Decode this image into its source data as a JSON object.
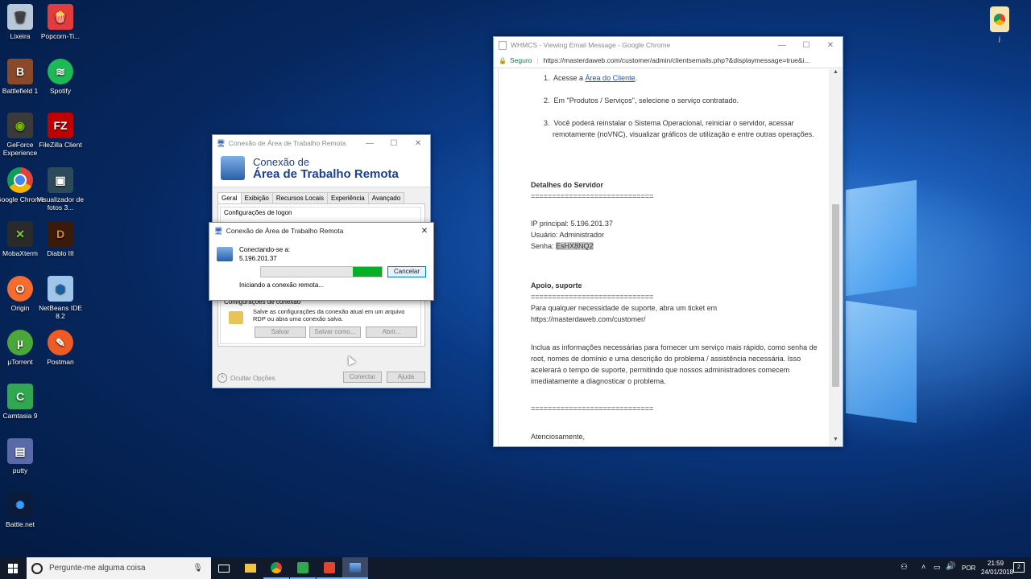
{
  "desktop": {
    "icons": [
      {
        "label": "Lixeira"
      },
      {
        "label": "Popcorn-Ti..."
      },
      {
        "label": "Battlefield 1"
      },
      {
        "label": "Spotify"
      },
      {
        "label": "GeForce Experience"
      },
      {
        "label": "FileZilla Client"
      },
      {
        "label": "Google Chrome"
      },
      {
        "label": "Visualizador de fotos 3..."
      },
      {
        "label": "MobaXterm"
      },
      {
        "label": "Diablo III"
      },
      {
        "label": "Origin"
      },
      {
        "label": "NetBeans IDE 8.2"
      },
      {
        "label": "µTorrent"
      },
      {
        "label": "Postman"
      },
      {
        "label": "Camtasia 9"
      },
      {
        "label": "putty"
      },
      {
        "label": "Battle.net"
      },
      {
        "label": "j"
      }
    ]
  },
  "rdp": {
    "title": "Conexão de Área de Trabalho Remota",
    "banner_line1": "Conexão de",
    "banner_line2": "Área de Trabalho Remota",
    "tabs": [
      "Geral",
      "Exibição",
      "Recursos Locais",
      "Experiência",
      "Avançado"
    ],
    "logon_group": "Configurações de logon",
    "conn_group": "Configurações de conexão",
    "conn_text": "Salve as configurações da conexão atual em um arquivo RDP ou abra uma conexão salva.",
    "save_label": "Salvar",
    "save_as_label": "Salvar como...",
    "open_label": "Abrir...",
    "hide_options": "Ocultar Opções",
    "connect_label": "Conectar",
    "help_label": "Ajuda"
  },
  "connecting": {
    "title": "Conexão de Área de Trabalho Remota",
    "connecting_to": "Conectando-se a:",
    "ip": "5.196.201.37",
    "status": "Iniciando a conexão remota...",
    "cancel_label": "Cancelar"
  },
  "chrome": {
    "title": "WHMCS - Viewing Email Message - Google Chrome",
    "secure_label": "Seguro",
    "url": "https://masterdaweb.com/customer/admin/clientsemails.php?&displaymessage=true&i...",
    "item1_prefix": "Acesse a ",
    "item1_link": "Área do Cliente",
    "item1_suffix": ".",
    "item2": "Em \"Produtos / Serviços\", selecione o serviço contratado.",
    "item3_l1": "Você poderá reinstalar o Sistema Operacional, reiniciar o servidor, acessar",
    "item3_l2": "remotamente (noVNC), visualizar gráficos de utilização e entre outras operações.",
    "details_title": "Detalhes do Servidor",
    "separator": "=============================",
    "ip_line": "IP principal: 5.196.201.37",
    "user_line": "Usuário: Administrador",
    "pass_label": "Senha: ",
    "pass_value": "EsHX8NQ2",
    "support_title": "Apoio, suporte",
    "support_l1": "Para qualquer necessidade de suporte, abra um ticket em",
    "support_l2": "https://masterdaweb.com/customer/",
    "info_l1": "Inclua as informações necessárias para fornecer um serviço mais rápido, como senha de",
    "info_l2": "root, nomes de domínio e uma descrição do problema / assistência necessária. Isso",
    "info_l3": "acelerará o tempo de suporte, permitindo que nossos administradores comecem",
    "info_l4": "imediatamente a diagnosticar o problema.",
    "regards": "Atenciosamente,"
  },
  "taskbar": {
    "search_placeholder": "Pergunte-me alguma coisa",
    "lang": "POR",
    "time": "21:59",
    "date": "24/01/2018",
    "notif_count": "2"
  }
}
